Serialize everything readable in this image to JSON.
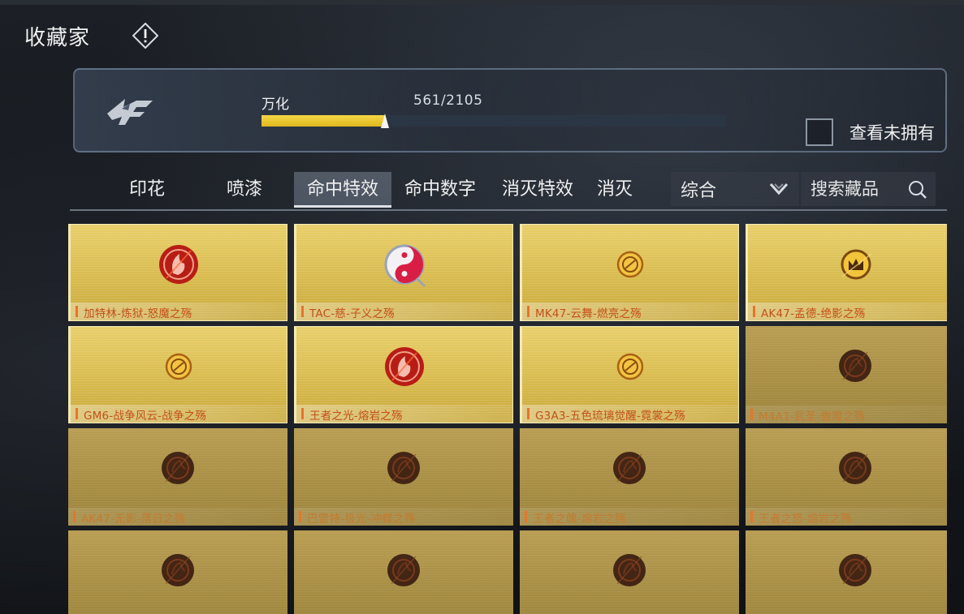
{
  "header": {
    "title": "收藏家"
  },
  "progress": {
    "tier_label": "万化",
    "collected": 561,
    "total": 2105,
    "count_text": "561/2105",
    "fraction": 0.2665
  },
  "filter": {
    "unowned_label": "查看未拥有",
    "unowned_checked": false
  },
  "tabs": [
    {
      "label": "印花",
      "active": false
    },
    {
      "label": "喷漆",
      "active": false
    },
    {
      "label": "命中特效",
      "active": true
    },
    {
      "label": "命中数字",
      "active": false
    },
    {
      "label": "消灭特效",
      "active": false
    },
    {
      "label": "消灭",
      "active": false
    }
  ],
  "sort": {
    "selected": "综合"
  },
  "search": {
    "placeholder": "搜索藏品"
  },
  "colors": {
    "accent_yellow": "#f0cc35",
    "card_gold": "#d8bb4e",
    "card_locked": "#a98f45",
    "name_orange": "#c4501b"
  },
  "items": [
    {
      "name": "加特林-炼狱-怒魔之殇",
      "owned": true,
      "icon": "red-flame-emblem-icon"
    },
    {
      "name": "TAC-慈-子义之殇",
      "owned": true,
      "icon": "yin-yang-emblem-icon"
    },
    {
      "name": "MK47-云舞-燃亮之殇",
      "owned": true,
      "icon": "gold-emblem-icon"
    },
    {
      "name": "AK47-孟德-绝影之殇",
      "owned": true,
      "icon": "gold-crown-emblem-icon"
    },
    {
      "name": "GM6-战争风云-战争之殇",
      "owned": true,
      "icon": "gold-emblem-icon"
    },
    {
      "name": "王者之光-熔岩之殇",
      "owned": true,
      "icon": "red-flame-emblem-icon"
    },
    {
      "name": "G3A3-五色琉璃觉醒-霓裳之殇",
      "owned": true,
      "icon": "gold-emblem-icon"
    },
    {
      "name": "M4A1-武圣-傲魔之殇",
      "owned": false,
      "icon": "dark-emblem-icon"
    },
    {
      "name": "AK47-无影-落日之殇",
      "owned": false,
      "icon": "dark-emblem-icon"
    },
    {
      "name": "巴雷特-极光-冲蝶之殇",
      "owned": false,
      "icon": "dark-emblem-icon"
    },
    {
      "name": "王者之魄-熔岩之殇",
      "owned": false,
      "icon": "dark-emblem-icon"
    },
    {
      "name": "王者之怒-熔岩之殇",
      "owned": false,
      "icon": "dark-emblem-icon"
    },
    {
      "name": "",
      "owned": false,
      "icon": "dark-emblem-icon"
    },
    {
      "name": "",
      "owned": false,
      "icon": "dark-emblem-icon"
    },
    {
      "name": "",
      "owned": false,
      "icon": "dark-emblem-icon"
    },
    {
      "name": "",
      "owned": false,
      "icon": "dark-emblem-icon"
    }
  ]
}
